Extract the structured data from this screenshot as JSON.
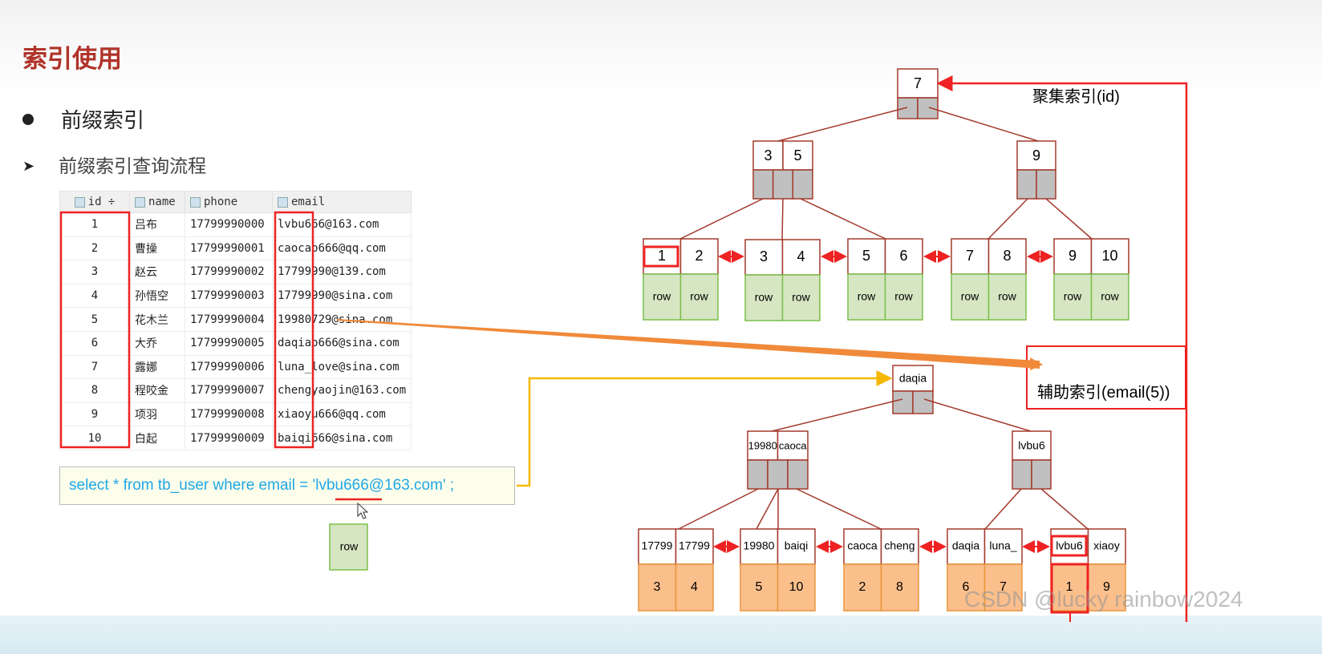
{
  "title": "索引使用",
  "bullet1": "前缀索引",
  "bullet2": "前缀索引查询流程",
  "table": {
    "columns": [
      "id",
      "name",
      "phone",
      "email"
    ],
    "rows": [
      [
        "1",
        "吕布",
        "17799990000",
        "lvbu666@163.com"
      ],
      [
        "2",
        "曹操",
        "17799990001",
        "caocao666@qq.com"
      ],
      [
        "3",
        "赵云",
        "17799990002",
        "17799990@139.com"
      ],
      [
        "4",
        "孙悟空",
        "17799990003",
        "17799990@sina.com"
      ],
      [
        "5",
        "花木兰",
        "17799990004",
        "19980729@sina.com"
      ],
      [
        "6",
        "大乔",
        "17799990005",
        "daqiao666@sina.com"
      ],
      [
        "7",
        "露娜",
        "17799990006",
        "luna_love@sina.com"
      ],
      [
        "8",
        "程咬金",
        "17799990007",
        "chengyaojin@163.com"
      ],
      [
        "9",
        "项羽",
        "17799990008",
        "xiaoyu666@qq.com"
      ],
      [
        "10",
        "白起",
        "17799990009",
        "baiqi666@sina.com"
      ]
    ]
  },
  "sql": "select * from tb_user where email = 'lvbu666@163.com' ;",
  "row_label": "row",
  "clustered_label": "聚集索引(id)",
  "secondary_label": "辅助索引(email(5))",
  "watermark": "CSDN @lucky rainbow2024",
  "clustered_tree": {
    "root": [
      "7"
    ],
    "level2": [
      [
        "3",
        "5"
      ],
      [
        "9"
      ]
    ],
    "leaves": [
      [
        "1",
        "2"
      ],
      [
        "3",
        "4"
      ],
      [
        "5",
        "6"
      ],
      [
        "7",
        "8"
      ],
      [
        "9",
        "10"
      ]
    ]
  },
  "secondary_tree": {
    "root": [
      "daqia"
    ],
    "level2": [
      [
        "19980",
        "caoca"
      ],
      [
        "lvbu6"
      ]
    ],
    "leaves": [
      {
        "keys": [
          "17799",
          "17799"
        ],
        "ids": [
          "3",
          "4"
        ]
      },
      {
        "keys": [
          "19980",
          "baiqi"
        ],
        "ids": [
          "5",
          "10"
        ]
      },
      {
        "keys": [
          "caoca",
          "cheng"
        ],
        "ids": [
          "2",
          "8"
        ]
      },
      {
        "keys": [
          "daqia",
          "luna_"
        ],
        "ids": [
          "6",
          "7"
        ]
      },
      {
        "keys": [
          "lvbu6",
          "xiaoy"
        ],
        "ids": [
          "1",
          "9"
        ]
      }
    ]
  },
  "colors": {
    "title": "#b0342a",
    "node_border": "#a33a2c",
    "highlight": "#ee2222",
    "row_green": "#d6e6c3",
    "row_border": "#7cbf4a",
    "id_orange": "#fbbf8c",
    "sql_text": "#1ea8e6",
    "yellow_line": "#f5b800",
    "orange_arrow": "#f08a3a"
  }
}
